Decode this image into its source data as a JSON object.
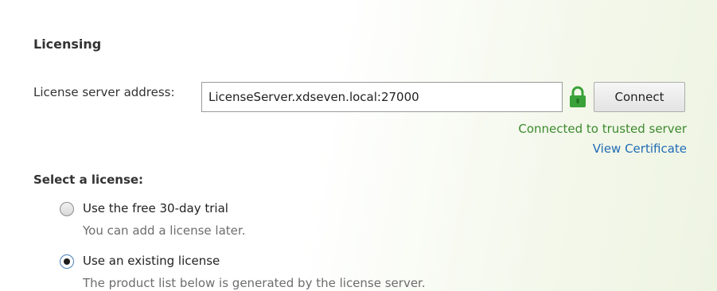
{
  "section": {
    "title": "Licensing"
  },
  "license_server": {
    "label": "License server address:",
    "value": "LicenseServer.xdseven.local:27000",
    "lock_icon": "padlock-icon",
    "lock_color": "#3aa23a",
    "connect_label": "Connect",
    "status_text": "Connected to trusted server",
    "status_color": "#3c8a2e",
    "view_certificate_label": "View Certificate"
  },
  "license_selection": {
    "label": "Select a license:",
    "options": [
      {
        "label": "Use the free 30-day trial",
        "description": "You can add a license later.",
        "selected": false
      },
      {
        "label": "Use an existing license",
        "description": "The product list below is generated by the license server.",
        "selected": true
      }
    ]
  }
}
